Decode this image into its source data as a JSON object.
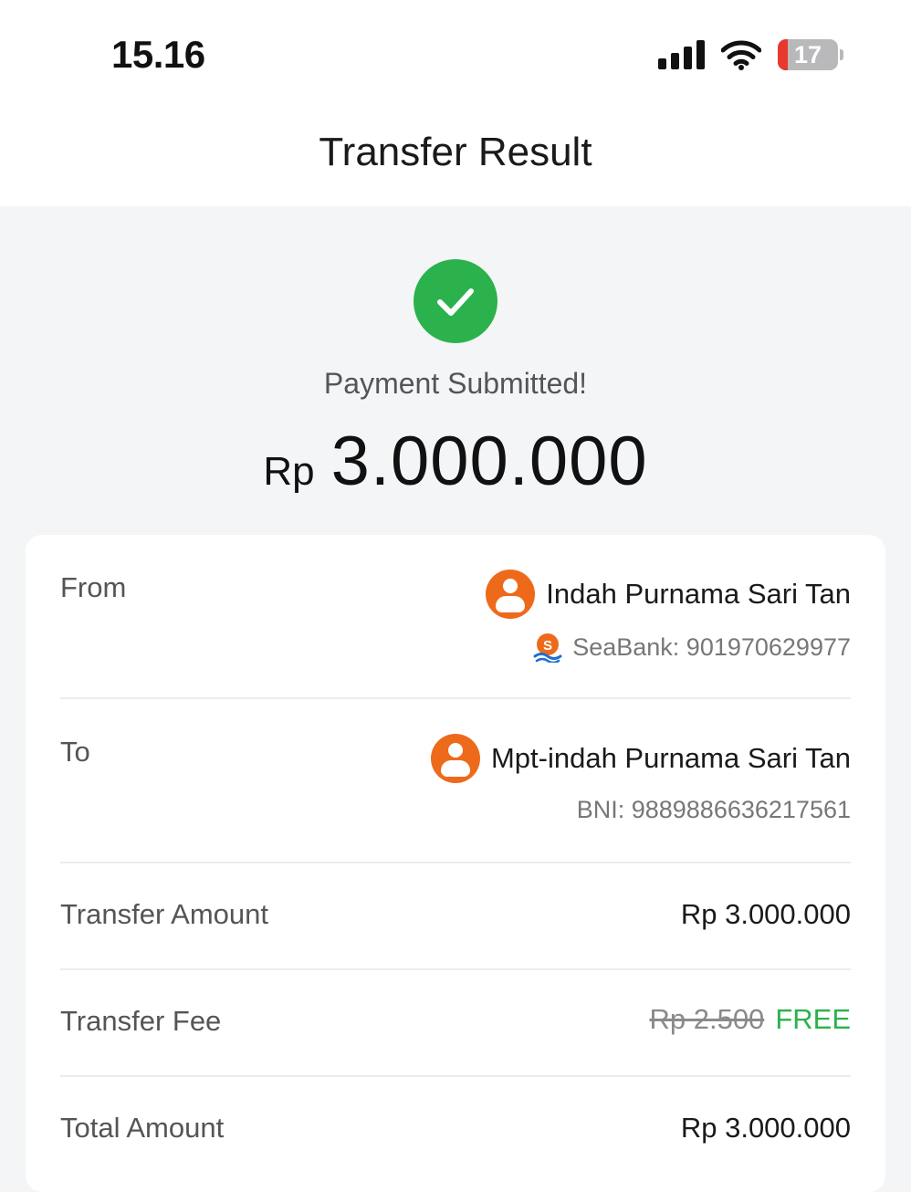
{
  "status_bar": {
    "time": "15.16",
    "battery_level": "17",
    "icons": [
      "signal-icon",
      "wifi-icon",
      "battery-icon"
    ]
  },
  "header": {
    "title": "Transfer Result"
  },
  "result": {
    "icon": "check-icon",
    "status_text": "Payment Submitted!",
    "currency": "Rp",
    "amount": "3.000.000",
    "accent_color": "#2bb24c"
  },
  "details": {
    "from": {
      "label": "From",
      "name": "Indah Purnama Sari Tan",
      "account": "SeaBank: 901970629977",
      "bank_icon": "seabank-logo-icon"
    },
    "to": {
      "label": "To",
      "name": "Mpt-indah Purnama Sari Tan",
      "account": "BNI: 9889886636217561"
    },
    "transfer_amount": {
      "label": "Transfer Amount",
      "value": "Rp 3.000.000"
    },
    "transfer_fee": {
      "label": "Transfer Fee",
      "original": "Rp 2.500",
      "value": "FREE"
    },
    "total_amount": {
      "label": "Total Amount",
      "value": "Rp 3.000.000"
    }
  }
}
